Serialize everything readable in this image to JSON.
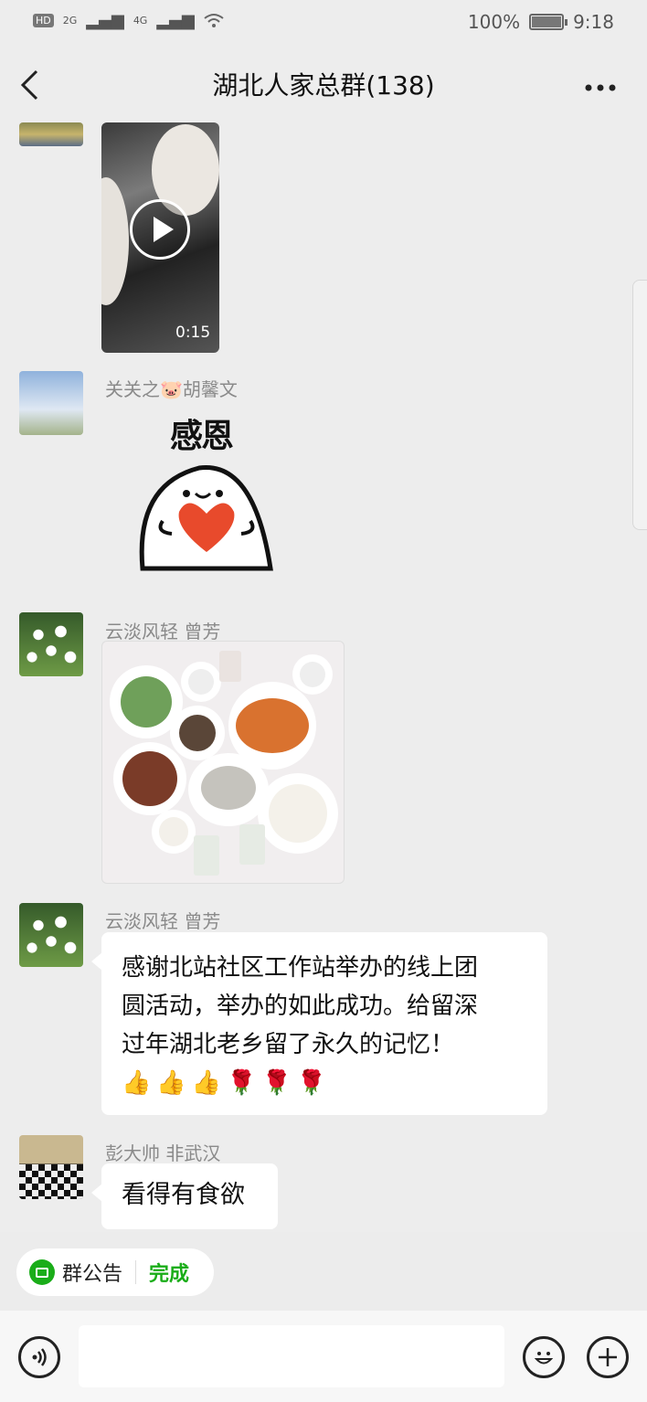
{
  "status_bar": {
    "hd": "HD",
    "net1": "2G",
    "net2": "4G",
    "battery": "100%",
    "battery_level": 1.0,
    "time": "9:18"
  },
  "header": {
    "back_icon": "chevron-left-icon",
    "title": "湖北人家总群(138)",
    "more_icon": "more-horizontal-icon"
  },
  "messages": [
    {
      "type": "video",
      "duration": "0:15"
    },
    {
      "type": "sticker",
      "sender": "关关之🐷胡馨文",
      "sticker_text": "感恩"
    },
    {
      "type": "image",
      "sender": "云淡风轻 曾芳"
    },
    {
      "type": "text",
      "sender": "云淡风轻 曾芳",
      "text_line1": "感谢北站社区工作站举办的线上团",
      "text_line2": "圆活动，举办的如此成功。给留深",
      "text_line3": "过年湖北老乡留了永久的记忆！",
      "emoji_line": "👍👍👍🌹🌹🌹"
    },
    {
      "type": "text",
      "sender": "彭大帅 非武汉",
      "text": "看得有食欲"
    }
  ],
  "bottom": {
    "notice_label": "群公告",
    "notice_action": "完成",
    "voice_icon": "voice-icon",
    "emoji_icon": "emoji-icon",
    "plus_icon": "plus-icon"
  },
  "colors": {
    "accent": "#1aad19",
    "background": "#ededed"
  }
}
